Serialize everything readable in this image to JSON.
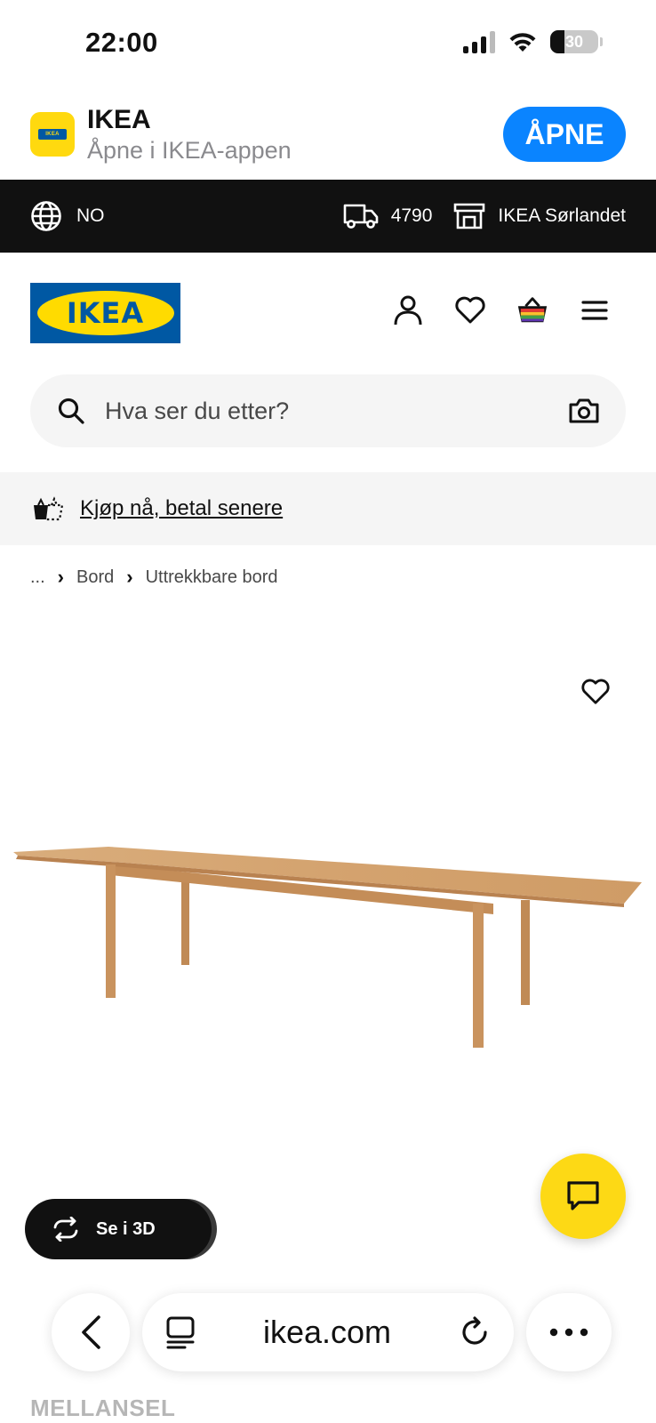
{
  "status_bar": {
    "time": "22:00",
    "battery": "30"
  },
  "app_banner": {
    "name": "IKEA",
    "subtitle": "Åpne i IKEA-appen",
    "open_label": "ÅPNE",
    "icon_text": "IKEA"
  },
  "top_bar": {
    "language": "NO",
    "postal_code": "4790",
    "store": "IKEA Sørlandet"
  },
  "header": {
    "logo_text": "IKEA"
  },
  "search": {
    "placeholder": "Hva ser du etter?"
  },
  "promo": {
    "link_text": "Kjøp nå, betal senere"
  },
  "breadcrumb": {
    "ellipsis": "...",
    "items": [
      "Bord",
      "Uttrekkbare bord"
    ]
  },
  "product": {
    "view_3d_label": "Se i 3D",
    "product_name": "MELLANSEL"
  },
  "browser": {
    "url": "ikea.com"
  },
  "colors": {
    "ikea_blue": "#0058a3",
    "ikea_yellow": "#ffdb00",
    "chat_yellow": "#fdd915",
    "ios_blue": "#0a84ff"
  }
}
